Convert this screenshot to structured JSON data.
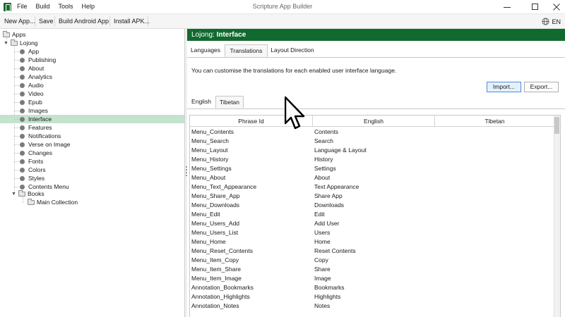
{
  "window": {
    "title": "Scripture App Builder",
    "menu": [
      "File",
      "Build",
      "Tools",
      "Help"
    ]
  },
  "toolbar": {
    "new_app": "New App...",
    "save": "Save",
    "build_android": "Build Android App",
    "install_apk": "Install APK...",
    "language": "EN"
  },
  "tree": {
    "root": "Apps",
    "app": "Lojong",
    "items": [
      "App",
      "Publishing",
      "About",
      "Analytics",
      "Audio",
      "Video",
      "Epub",
      "Images",
      "Interface",
      "Features",
      "Notifications",
      "Verse on Image",
      "Changes",
      "Fonts",
      "Colors",
      "Styles",
      "Contents Menu"
    ],
    "selected": "Interface",
    "books": "Books",
    "collection": "Main Collection"
  },
  "header": {
    "app_name": "Lojong:",
    "section": "Interface"
  },
  "tabs": [
    "Languages",
    "Translations",
    "Layout Direction"
  ],
  "active_tab": "Translations",
  "description": "You can customise the translations for each enabled user interface language.",
  "buttons": {
    "import": "Import...",
    "export": "Export..."
  },
  "lang_tabs": [
    "English",
    "Tibetan"
  ],
  "active_lang_tab": "Tibetan",
  "table": {
    "columns": [
      "Phrase Id",
      "English",
      "Tibetan"
    ],
    "rows": [
      [
        "Menu_Contents",
        "Contents",
        ""
      ],
      [
        "Menu_Search",
        "Search",
        ""
      ],
      [
        "Menu_Layout",
        "Language & Layout",
        ""
      ],
      [
        "Menu_History",
        "History",
        ""
      ],
      [
        "Menu_Settings",
        "Settings",
        ""
      ],
      [
        "Menu_About",
        "About",
        ""
      ],
      [
        "Menu_Text_Appearance",
        "Text Appearance",
        ""
      ],
      [
        "Menu_Share_App",
        "Share App",
        ""
      ],
      [
        "Menu_Downloads",
        "Downloads",
        ""
      ],
      [
        "Menu_Edit",
        "Edit",
        ""
      ],
      [
        "Menu_Users_Add",
        "Add User",
        ""
      ],
      [
        "Menu_Users_List",
        "Users",
        ""
      ],
      [
        "Menu_Home",
        "Home",
        ""
      ],
      [
        "Menu_Reset_Contents",
        "Reset Contents",
        ""
      ],
      [
        "Menu_Item_Copy",
        "Copy",
        ""
      ],
      [
        "Menu_Item_Share",
        "Share",
        ""
      ],
      [
        "Menu_Item_Image",
        "Image",
        ""
      ],
      [
        "Annotation_Bookmarks",
        "Bookmarks",
        ""
      ],
      [
        "Annotation_Highlights",
        "Highlights",
        ""
      ],
      [
        "Annotation_Notes",
        "Notes",
        ""
      ]
    ]
  },
  "colors": {
    "header_bg": "#12692f",
    "selected_row": "#c4e3cf",
    "primary_button_border": "#4a90d9"
  }
}
